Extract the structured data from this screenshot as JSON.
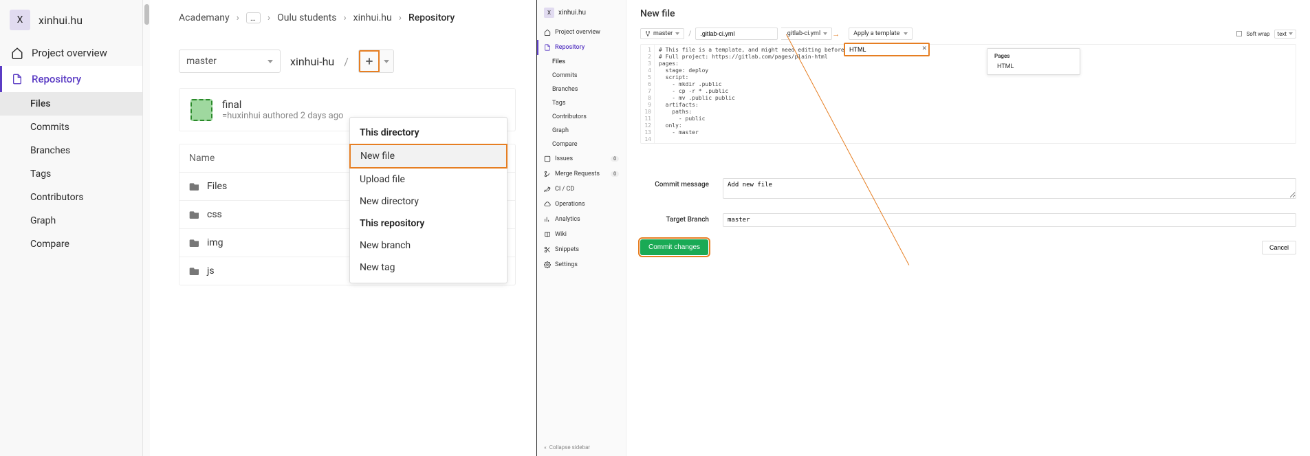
{
  "left": {
    "project": {
      "avatar_letter": "X",
      "name": "xinhui.hu"
    },
    "nav": {
      "overview": "Project overview",
      "repository": "Repository",
      "subs": [
        "Files",
        "Commits",
        "Branches",
        "Tags",
        "Contributors",
        "Graph",
        "Compare"
      ]
    },
    "breadcrumbs": [
      "Academany",
      "…",
      "Oulu students",
      "xinhui.hu",
      "Repository"
    ],
    "branch": "master",
    "path_label": "xinhui-hu",
    "commit": {
      "title": "final",
      "sub": "=huxinhui authored 2 days ago"
    },
    "table": {
      "header": "Name",
      "rows": [
        "Files",
        "css",
        "img",
        "js"
      ]
    },
    "dropdown": {
      "heading1": "This directory",
      "items1": [
        "New file",
        "Upload file",
        "New directory"
      ],
      "heading2": "This repository",
      "items2": [
        "New branch",
        "New tag"
      ]
    }
  },
  "right": {
    "project": {
      "avatar_letter": "X",
      "name": "xinhui.hu"
    },
    "nav": {
      "overview": "Project overview",
      "repository": "Repository",
      "repo_subs": [
        "Files",
        "Commits",
        "Branches",
        "Tags",
        "Contributors",
        "Graph",
        "Compare"
      ],
      "issues": "Issues",
      "issues_badge": "0",
      "merge": "Merge Requests",
      "merge_badge": "0",
      "cicd": "CI / CD",
      "ops": "Operations",
      "analytics": "Analytics",
      "wiki": "Wiki",
      "snippets": "Snippets",
      "settings": "Settings",
      "collapse": "Collapse sidebar"
    },
    "title": "New file",
    "branch": "master",
    "filename_value": ".gitlab-ci.yml",
    "ext_label": ".gitlab-ci.yml",
    "template_btn": "Apply a template",
    "template_input": "HTML",
    "template_dropdown": {
      "heading": "Pages",
      "items": [
        "HTML"
      ]
    },
    "softwrap": "Soft wrap",
    "text_sel": "text",
    "code_lines": [
      "# This file is a template, and might need editing before it works on your project.",
      "# Full project: https://gitlab.com/pages/plain-html",
      "pages:",
      "  stage: deploy",
      "  script:",
      "    - mkdir .public",
      "    - cp -r * .public",
      "    - mv .public public",
      "  artifacts:",
      "    paths:",
      "      - public",
      "  only:",
      "    - master",
      ""
    ],
    "form": {
      "commit_label": "Commit message",
      "commit_value": "Add new file",
      "branch_label": "Target Branch",
      "branch_value": "master"
    },
    "commit_btn": "Commit changes",
    "cancel_btn": "Cancel"
  }
}
